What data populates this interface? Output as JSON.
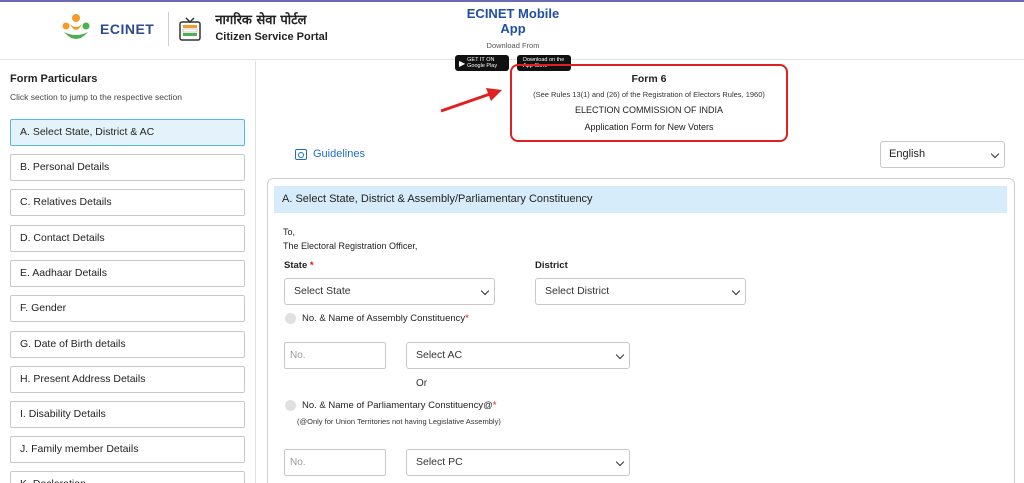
{
  "header": {
    "brand": "ECINET",
    "portal_hindi": "नागरिक सेवा पोर्टल",
    "portal_en": "Citizen Service Portal",
    "app_title": "ECINET Mobile App",
    "app_download": "Download From",
    "google_play": {
      "top": "GET IT ON",
      "bottom": "Google Play"
    },
    "app_store": {
      "top": "Download on the",
      "bottom": "App Store"
    }
  },
  "sidebar": {
    "title": "Form Particulars",
    "subtitle": "Click section to jump to the respective section",
    "items": [
      {
        "label": "A. Select State, District & AC"
      },
      {
        "label": "B. Personal Details"
      },
      {
        "label": "C. Relatives Details"
      },
      {
        "label": "D. Contact Details"
      },
      {
        "label": "E. Aadhaar Details"
      },
      {
        "label": "F. Gender"
      },
      {
        "label": "G. Date of Birth details"
      },
      {
        "label": "H. Present Address Details"
      },
      {
        "label": "I. Disability Details"
      },
      {
        "label": "J. Family member Details"
      },
      {
        "label": "K. Declaration"
      }
    ]
  },
  "form_header": {
    "title": "Form 6",
    "rules": "(See Rules 13(1) and (26) of the Registration of Electors Rules, 1960)",
    "commission": "ELECTION COMMISSION OF INDIA",
    "form_name": "Application Form for New Voters"
  },
  "guidelines_label": "Guidelines",
  "language": {
    "selected": "English"
  },
  "section_a": {
    "heading": "A. Select State, District & Assembly/Parliamentary Constituency",
    "to_line1": "To,",
    "to_line2": "The Electoral Registration Officer,",
    "state_label": "State",
    "required_mark": "*",
    "state_select": "Select State",
    "district_label": "District",
    "district_select": "Select District",
    "ac_label": "No. & Name of Assembly Constituency",
    "ac_no_placeholder": "No.",
    "ac_select": "Select AC",
    "or_text": "Or",
    "pc_label": "No. & Name of Parliamentary Constituency@",
    "pc_note": "(@Only for Union Territories not having Legislative Assembly)",
    "pc_no_placeholder": "No.",
    "pc_select": "Select PC"
  },
  "colors": {
    "accent": "#1f6fc1",
    "highlight_border": "#e02020",
    "section_bg": "#d7ecfa",
    "active_item_bg": "#e4f3fb"
  }
}
